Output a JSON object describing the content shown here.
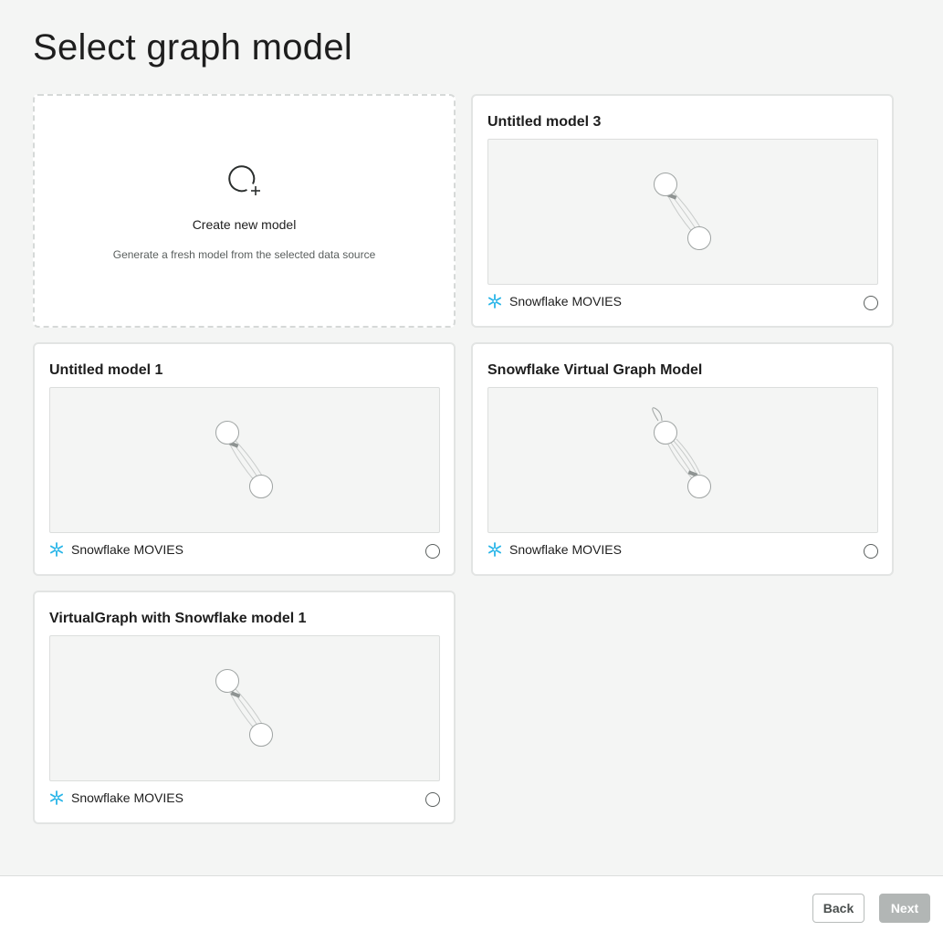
{
  "page": {
    "title": "Select graph model"
  },
  "create_card": {
    "title": "Create new model",
    "subtitle": "Generate a fresh model from the selected data source"
  },
  "models": [
    {
      "title": "Untitled model 3",
      "source": "Snowflake MOVIES",
      "selected": false
    },
    {
      "title": "Untitled model 1",
      "source": "Snowflake MOVIES",
      "selected": false
    },
    {
      "title": "Snowflake Virtual Graph Model",
      "source": "Snowflake MOVIES",
      "selected": false
    },
    {
      "title": "VirtualGraph with Snowflake model 1",
      "source": "Snowflake MOVIES",
      "selected": false
    }
  ],
  "footer": {
    "back_label": "Back",
    "next_label": "Next"
  },
  "colors": {
    "snowflake_icon": "#29b5e8",
    "next_disabled": "#b2b6b5"
  },
  "icons": {
    "create": "circle-plus-icon",
    "source": "snowflake-icon"
  }
}
